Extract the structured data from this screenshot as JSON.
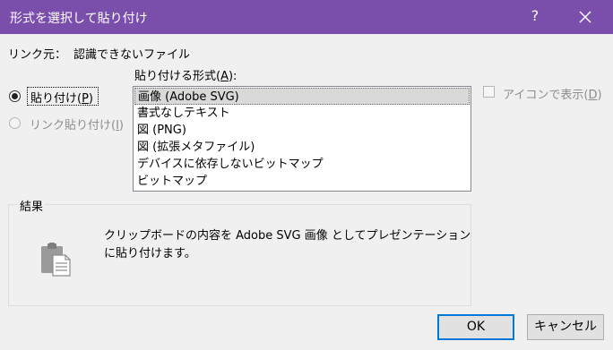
{
  "window": {
    "title": "形式を選択して貼り付け"
  },
  "source": {
    "label": "リンク元：",
    "value": "認識できないファイル"
  },
  "formats": {
    "label": "貼り付ける形式(A):",
    "label_pre": "貼り付ける形式(",
    "label_key": "A",
    "label_post": "):",
    "items": [
      "画像 (Adobe SVG)",
      "書式なしテキスト",
      "図 (PNG)",
      "図 (拡張メタファイル)",
      "デバイスに依存しないビットマップ",
      "ビットマップ"
    ],
    "selected": "画像 (Adobe SVG)"
  },
  "paste_options": {
    "paste": {
      "label": "貼り付け(P)",
      "label_pre": "貼り付け(",
      "label_key": "P",
      "label_post": ")",
      "checked": true
    },
    "paste_link": {
      "label": "リンク貼り付け(I)",
      "label_pre": "リンク貼り付け(",
      "label_key": "I",
      "label_post": ")",
      "checked": false,
      "disabled": true
    }
  },
  "display_as_icon": {
    "label": "アイコンで表示(D)",
    "label_pre": "アイコンで表示(",
    "label_key": "D",
    "label_post": ")",
    "checked": false,
    "disabled": true
  },
  "result": {
    "title": "結果",
    "line1": "クリップボードの内容を Adobe SVG 画像 としてプレゼンテーション",
    "line2": "に貼り付けます。"
  },
  "buttons": {
    "ok": "OK",
    "cancel": "キャンセル"
  },
  "titlebar_buttons": {
    "help": "?"
  },
  "colors": {
    "titlebar": "#7a4eab",
    "accent": "#0078d7",
    "selection": "#d9d9d9"
  }
}
